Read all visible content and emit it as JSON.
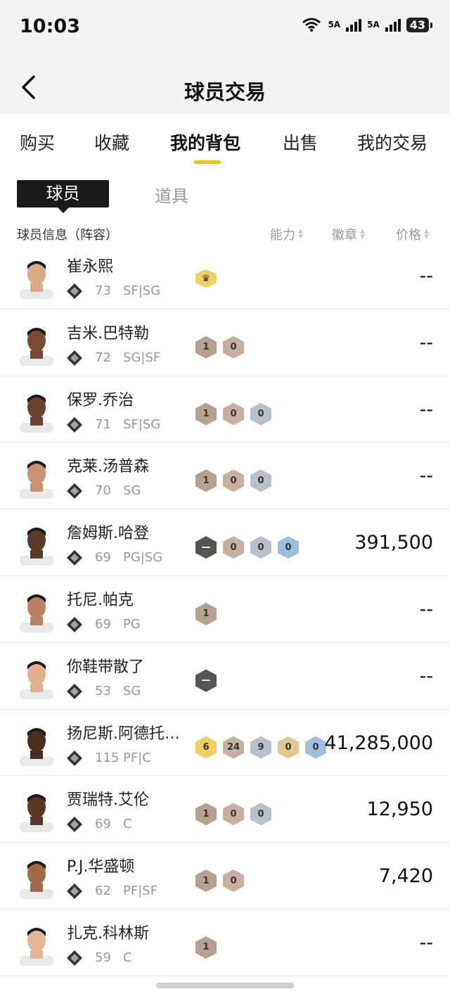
{
  "status": {
    "time": "10:03",
    "net1": "5A",
    "net2": "5A",
    "battery": "43"
  },
  "header": {
    "title": "球员交易"
  },
  "tabs": [
    {
      "label": "购买"
    },
    {
      "label": "收藏"
    },
    {
      "label": "我的背包"
    },
    {
      "label": "出售"
    },
    {
      "label": "我的交易"
    }
  ],
  "subtabs": {
    "players": "球员",
    "items": "道具"
  },
  "columns": {
    "info": "球员信息（阵容）",
    "ability": "能力",
    "badge": "徽章",
    "price": "价格"
  },
  "players": [
    {
      "name": "崔永熙",
      "ovr": "73",
      "pos": "SF|SG",
      "price": "--",
      "badges": [
        {
          "t": "crown",
          "c": "#f0d060"
        }
      ],
      "type_icon": "star-icon"
    },
    {
      "name": "吉米.巴特勒",
      "ovr": "72",
      "pos": "SG|SF",
      "price": "--",
      "badges": [
        {
          "t": "1",
          "c": "#b8a090"
        },
        {
          "t": "0",
          "c": "#c8b0a0"
        }
      ],
      "type_icon": "copy-icon"
    },
    {
      "name": "保罗.乔治",
      "ovr": "71",
      "pos": "SF|SG",
      "price": "--",
      "badges": [
        {
          "t": "1",
          "c": "#b8a090"
        },
        {
          "t": "0",
          "c": "#c8b0a0"
        },
        {
          "t": "0",
          "c": "#b8c0cc"
        }
      ],
      "type_icon": "copy-icon"
    },
    {
      "name": "克莱.汤普森",
      "ovr": "70",
      "pos": "SG",
      "price": "--",
      "badges": [
        {
          "t": "1",
          "c": "#b8a090"
        },
        {
          "t": "0",
          "c": "#c8b0a0"
        },
        {
          "t": "0",
          "c": "#b8c0cc"
        }
      ],
      "type_icon": "copy-icon"
    },
    {
      "name": "詹姆斯.哈登",
      "ovr": "69",
      "pos": "PG|SG",
      "price": "391,500",
      "badges": [
        {
          "t": "—",
          "c": "#555"
        },
        {
          "t": "0",
          "c": "#c8b0a0"
        },
        {
          "t": "0",
          "c": "#b8c0cc"
        },
        {
          "t": "0",
          "c": "#9ec0e0"
        }
      ],
      "type_icon": "bars-icon"
    },
    {
      "name": "托尼.帕克",
      "ovr": "69",
      "pos": "PG",
      "price": "--",
      "badges": [
        {
          "t": "1",
          "c": "#b8a090"
        }
      ],
      "type_icon": "copy-icon"
    },
    {
      "name": "你鞋带散了",
      "ovr": "53",
      "pos": "SG",
      "price": "--",
      "badges": [
        {
          "t": "—",
          "c": "#555"
        }
      ],
      "type_icon": "person-icon"
    },
    {
      "name": "扬尼斯.阿德托…",
      "ovr": "115",
      "pos": "PF|C",
      "price": "41,285,000",
      "badges": [
        {
          "t": "6",
          "c": "#f0d060"
        },
        {
          "t": "24",
          "c": "#c8b0a0"
        },
        {
          "t": "9",
          "c": "#b8c0cc"
        },
        {
          "t": "0",
          "c": "#e0c890"
        },
        {
          "t": "0",
          "c": "#9ec0e0"
        }
      ],
      "type_icon": "bars-icon"
    },
    {
      "name": "贾瑞特.艾伦",
      "ovr": "69",
      "pos": "C",
      "price": "12,950",
      "badges": [
        {
          "t": "1",
          "c": "#b8a090"
        },
        {
          "t": "0",
          "c": "#c8b0a0"
        },
        {
          "t": "0",
          "c": "#b8c0cc"
        }
      ],
      "type_icon": "bars-icon"
    },
    {
      "name": "P.J.华盛顿",
      "ovr": "62",
      "pos": "PF|SF",
      "price": "7,420",
      "badges": [
        {
          "t": "1",
          "c": "#b8a090"
        },
        {
          "t": "0",
          "c": "#c8b0a0"
        }
      ],
      "type_icon": "bars-icon"
    },
    {
      "name": "扎克.科林斯",
      "ovr": "59",
      "pos": "C",
      "price": "--",
      "badges": [
        {
          "t": "1",
          "c": "#b8a090"
        }
      ],
      "type_icon": "bars-icon"
    }
  ]
}
